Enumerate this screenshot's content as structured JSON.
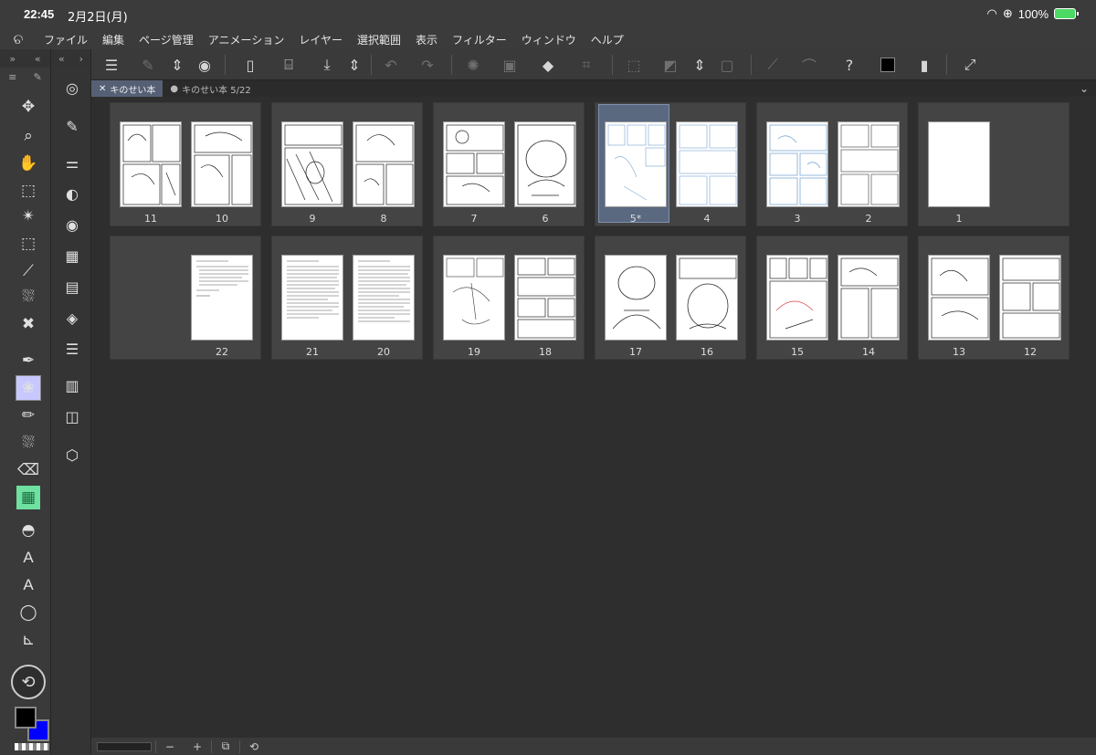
{
  "status": {
    "time": "22:45",
    "date": "2月2日(月)",
    "battery": "100%"
  },
  "menu": [
    "ファイル",
    "編集",
    "ページ管理",
    "アニメーション",
    "レイヤー",
    "選択範囲",
    "表示",
    "フィルター",
    "ウィンドウ",
    "ヘルプ"
  ],
  "tabs": [
    {
      "label": "キのせい本",
      "active": true
    },
    {
      "label": "キのせい本 5/22",
      "active": false
    }
  ],
  "pages_row1": [
    {
      "left": "11",
      "right": "10"
    },
    {
      "left": "9",
      "right": "8"
    },
    {
      "left": "7",
      "right": "6"
    },
    {
      "left": "5*",
      "right": "4"
    },
    {
      "left": "3",
      "right": "2"
    },
    {
      "left": "",
      "right": "1"
    }
  ],
  "pages_row2": [
    {
      "left": "",
      "right": "22"
    },
    {
      "left": "21",
      "right": "20"
    },
    {
      "left": "19",
      "right": "18"
    },
    {
      "left": "17",
      "right": "16"
    },
    {
      "left": "15",
      "right": "14"
    },
    {
      "left": "13",
      "right": "12"
    }
  ],
  "bottom": {
    "minus": "−",
    "plus": "+"
  },
  "colors": {
    "main": "#000000",
    "sub": "#0000ff",
    "accent": "#566075"
  }
}
